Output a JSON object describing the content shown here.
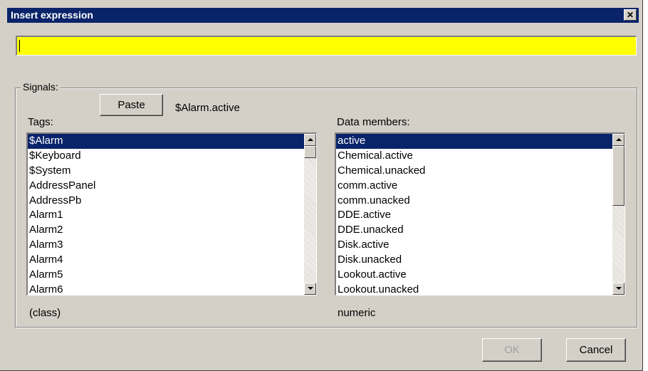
{
  "window": {
    "title": "Insert expression",
    "close_glyph": "✕"
  },
  "expression": {
    "value": ""
  },
  "signals": {
    "group_label": "Signals:",
    "paste_label": "Paste",
    "current_signal": "$Alarm.active",
    "tags_label": "Tags:",
    "data_members_label": "Data members:",
    "tags": [
      "$Alarm",
      "$Keyboard",
      "$System",
      "AddressPanel",
      "AddressPb",
      "Alarm1",
      "Alarm2",
      "Alarm3",
      "Alarm4",
      "Alarm5",
      "Alarm6"
    ],
    "data_members": [
      "active",
      "Chemical.active",
      "Chemical.unacked",
      "comm.active",
      "comm.unacked",
      "DDE.active",
      "DDE.unacked",
      "Disk.active",
      "Disk.unacked",
      "Lookout.active",
      "Lookout.unacked"
    ],
    "tag_type": "(class)",
    "member_type": "numeric"
  },
  "footer": {
    "ok_label": "OK",
    "cancel_label": "Cancel"
  },
  "colors": {
    "titlebar": "#0a246a",
    "selection": "#0a246a",
    "expression_bg": "#ffff00",
    "dialog_bg": "#d4d0c8"
  }
}
